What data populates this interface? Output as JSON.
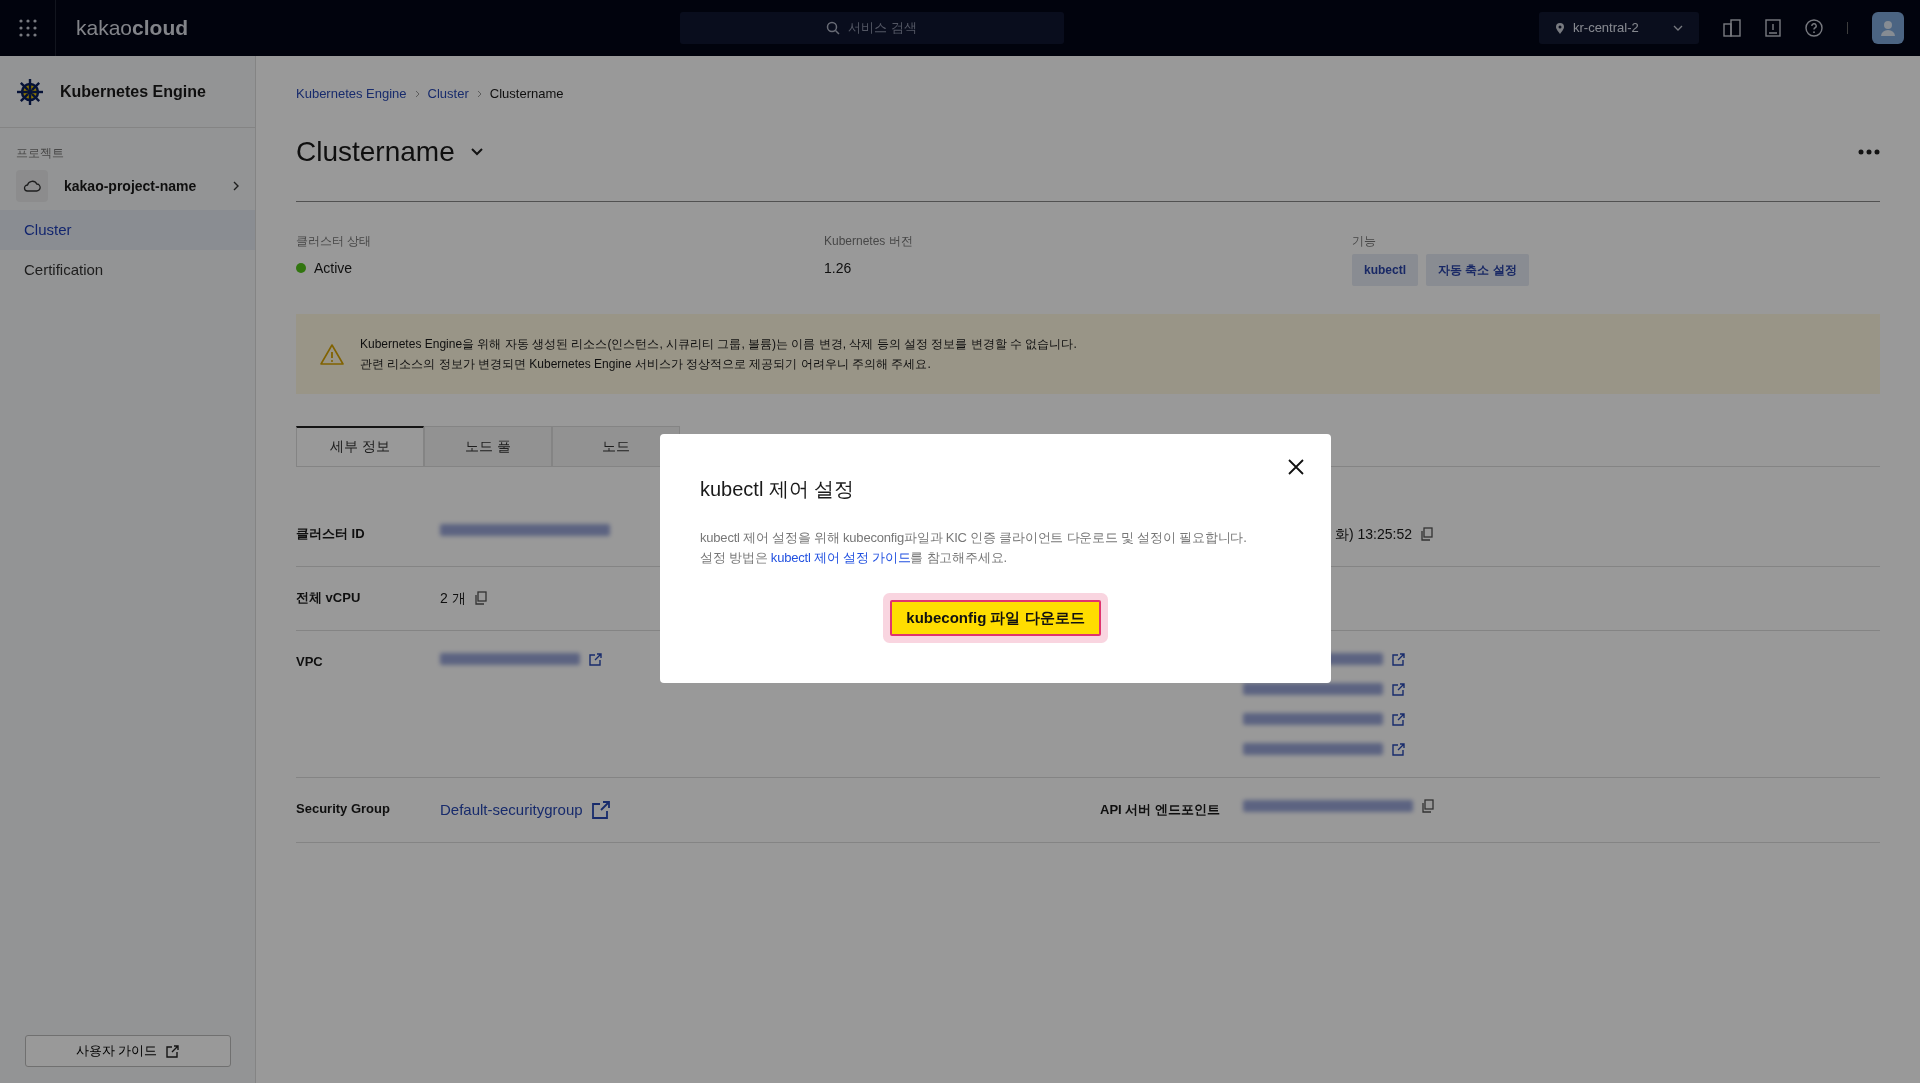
{
  "topbar": {
    "logo": "kakao**cloud**",
    "search": {
      "placeholder": "서비스 검색"
    },
    "region": "kr-central-2"
  },
  "sidebar": {
    "title": "Kubernetes Engine",
    "section_label": "프로젝트",
    "project": "kakao-project-name",
    "items": [
      {
        "label": "Cluster",
        "selected": true
      },
      {
        "label": "Certification",
        "selected": false
      }
    ],
    "guide_button": "사용자 가이드"
  },
  "breadcrumb": [
    "Kubernetes Engine",
    "Cluster",
    "Clustername"
  ],
  "title": "Clustername",
  "summary": {
    "status": {
      "label": "클러스터 상태",
      "value": "Active"
    },
    "version": {
      "label": "Kubernetes 버전",
      "value": "1.26"
    },
    "features": {
      "label": "기능",
      "buttons": [
        "kubectl",
        "자동 축소 설정"
      ]
    }
  },
  "warning": [
    "Kubernetes Engine을 위해 자동 생성된 리소스(인스턴스, 시큐리티 그룹, 볼륨)는 이름 변경, 삭제 등의 설정 정보를 변경할 수 없습니다.",
    "관련 리소스의 정보가 변경되면 Kubernetes Engine 서비스가 정상적으로 제공되기 어려우니 주의해 주세요."
  ],
  "tabs": [
    {
      "label": "세부 정보",
      "selected": true
    },
    {
      "label": "노드 풀",
      "selected": false
    },
    {
      "label": "노드",
      "selected": false
    }
  ],
  "details": [
    {
      "label": "클러스터 ID",
      "value": [
        {
          "kind": "redacted"
        }
      ],
      "right_value": [
        {
          "kind": "text",
          "text": "화) 13:25:52",
          "copy": true
        }
      ]
    },
    {
      "label": "전체 vCPU",
      "value": [
        {
          "kind": "text",
          "text": "2 개",
          "copy": true
        }
      ]
    },
    {
      "label": "VPC",
      "value": [
        {
          "kind": "redacted_link"
        }
      ],
      "right_value": [
        {
          "kind": "redacted_link"
        },
        {
          "kind": "redacted_link"
        },
        {
          "kind": "redacted_link"
        },
        {
          "kind": "redacted_link"
        }
      ]
    },
    {
      "label": "Security Group",
      "value": [
        {
          "kind": "link",
          "text": "Default-securitygroup"
        }
      ],
      "right_label": "API 서버 엔드포인트",
      "right_value": [
        {
          "kind": "redacted",
          "copy": true
        }
      ]
    }
  ],
  "modal": {
    "title": "kubectl 제어 설정",
    "line1": "kubectl  제어 설정을 위해 kubeconfig파일과 KIC 인증 클라이언트 다운로드 및 설정이 필요합니다.",
    "line2_prefix": "설정 방법은 ",
    "line2_link": "kubectl 제어 설정 가이드",
    "line2_suffix": "를 참고해주세요.",
    "button": "kubeconfig 파일 다운로드",
    "button_focused": true
  }
}
